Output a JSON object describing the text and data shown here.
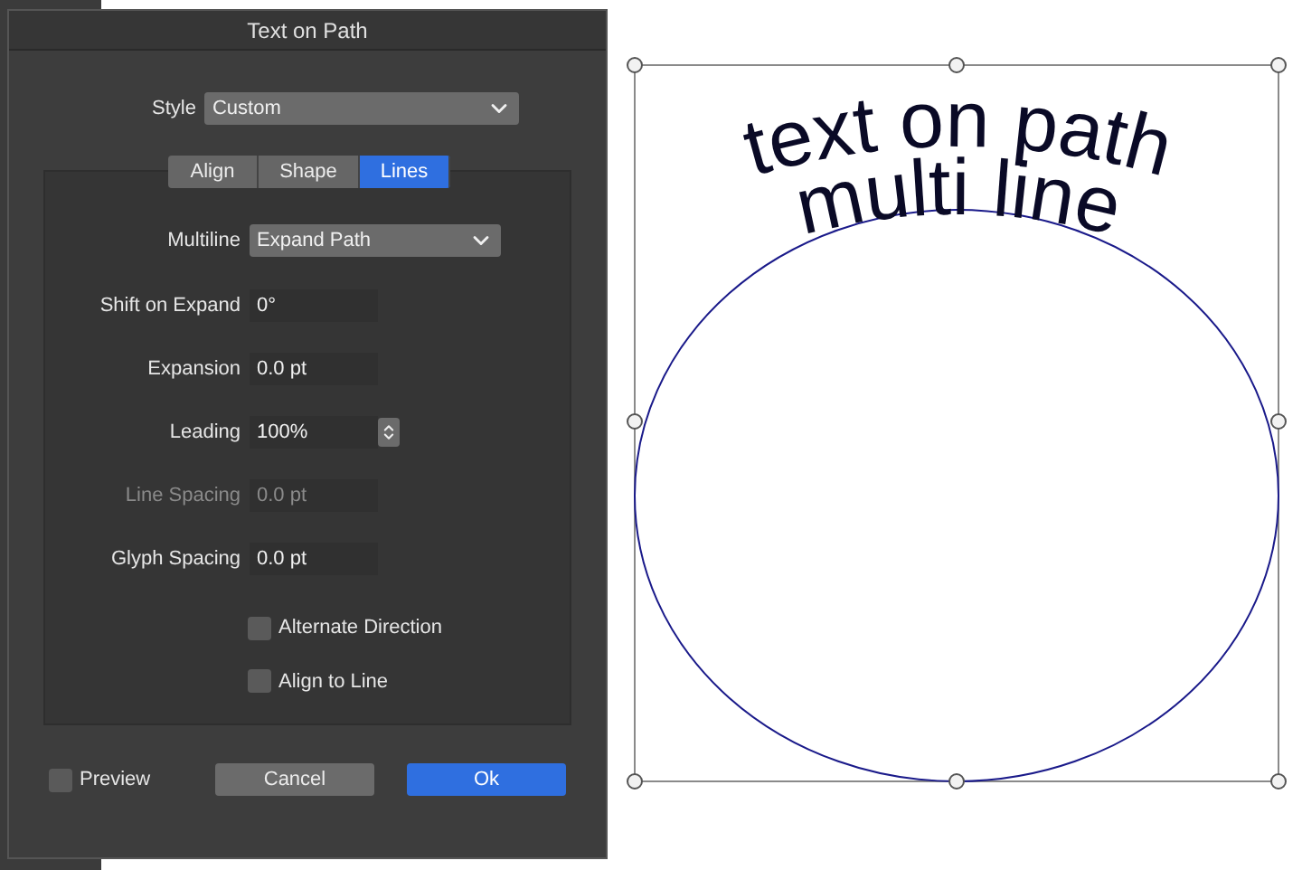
{
  "dialog": {
    "title": "Text on Path",
    "style": {
      "label": "Style",
      "value": "Custom"
    },
    "tabs": [
      {
        "label": "Align",
        "selected": false
      },
      {
        "label": "Shape",
        "selected": false
      },
      {
        "label": "Lines",
        "selected": true
      }
    ],
    "multiline": {
      "label": "Multiline",
      "value": "Expand Path"
    },
    "fields": [
      {
        "label": "Shift on Expand",
        "value": "0°",
        "kind": "field",
        "disabled": false
      },
      {
        "label": "Expansion",
        "value": "0.0 pt",
        "kind": "field",
        "disabled": false
      },
      {
        "label": "Leading",
        "value": "100%",
        "kind": "stepper",
        "disabled": false
      },
      {
        "label": "Line Spacing",
        "value": "0.0 pt",
        "kind": "field",
        "disabled": true
      },
      {
        "label": "Glyph Spacing",
        "value": "0.0 pt",
        "kind": "field",
        "disabled": false
      }
    ],
    "options": [
      {
        "label": "Alternate Direction",
        "checked": false
      },
      {
        "label": "Align to Line",
        "checked": false
      }
    ],
    "preview": {
      "label": "Preview",
      "checked": false
    },
    "buttons": [
      {
        "label": "Cancel",
        "kind": "secondary"
      },
      {
        "label": "Ok",
        "kind": "primary"
      }
    ]
  },
  "canvas": {
    "text_lines": [
      "text on path",
      "multi line"
    ]
  }
}
